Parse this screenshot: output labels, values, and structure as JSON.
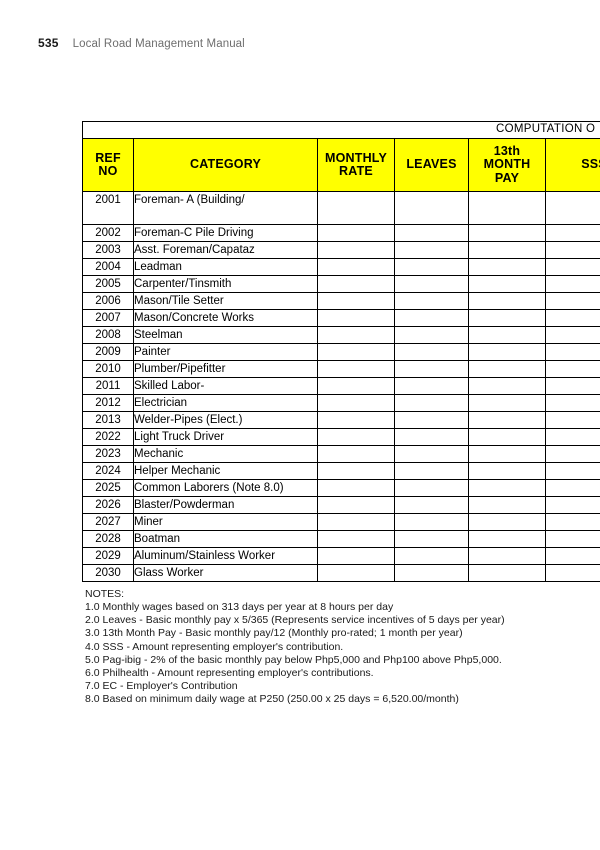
{
  "page_header": {
    "page_number": "535",
    "title": "Local Road Management Manual"
  },
  "table": {
    "banner_label": "COMPUTATION O",
    "columns": [
      {
        "key": "ref_no",
        "label": "REF\nNO"
      },
      {
        "key": "category",
        "label": "CATEGORY"
      },
      {
        "key": "monthly",
        "label": "MONTHLY\nRATE"
      },
      {
        "key": "leaves",
        "label": "LEAVES"
      },
      {
        "key": "thirteenth",
        "label": "13th\nMONTH\nPAY"
      },
      {
        "key": "sss",
        "label": "SSS"
      }
    ],
    "column_labels": {
      "ref_no_line1": "REF",
      "ref_no_line2": "NO",
      "category": "CATEGORY",
      "monthly_line1": "MONTHLY",
      "monthly_line2": "RATE",
      "leaves": "LEAVES",
      "thirteenth_line1": "13th",
      "thirteenth_line2": "MONTH",
      "thirteenth_line3": "PAY",
      "sss": "SSS"
    },
    "rows": [
      {
        "ref_no": "2001",
        "category": "Foreman- A (Building/",
        "monthly": "",
        "leaves": "",
        "thirteenth": "",
        "sss": "",
        "tall": true
      },
      {
        "ref_no": "2002",
        "category": "Foreman-C Pile Driving",
        "monthly": "",
        "leaves": "",
        "thirteenth": "",
        "sss": "",
        "tall": false
      },
      {
        "ref_no": "2003",
        "category": "Asst. Foreman/Capataz",
        "monthly": "",
        "leaves": "",
        "thirteenth": "",
        "sss": "",
        "tall": false
      },
      {
        "ref_no": "2004",
        "category": "Leadman",
        "monthly": "",
        "leaves": "",
        "thirteenth": "",
        "sss": "",
        "tall": false
      },
      {
        "ref_no": "2005",
        "category": "Carpenter/Tinsmith",
        "monthly": "",
        "leaves": "",
        "thirteenth": "",
        "sss": "",
        "tall": false
      },
      {
        "ref_no": "2006",
        "category": "Mason/Tile Setter",
        "monthly": "",
        "leaves": "",
        "thirteenth": "",
        "sss": "",
        "tall": false
      },
      {
        "ref_no": "2007",
        "category": "Mason/Concrete Works",
        "monthly": "",
        "leaves": "",
        "thirteenth": "",
        "sss": "",
        "tall": false
      },
      {
        "ref_no": "2008",
        "category": "Steelman",
        "monthly": "",
        "leaves": "",
        "thirteenth": "",
        "sss": "",
        "tall": false
      },
      {
        "ref_no": "2009",
        "category": "Painter",
        "monthly": "",
        "leaves": "",
        "thirteenth": "",
        "sss": "",
        "tall": false
      },
      {
        "ref_no": "2010",
        "category": "Plumber/Pipefitter",
        "monthly": "",
        "leaves": "",
        "thirteenth": "",
        "sss": "",
        "tall": false
      },
      {
        "ref_no": "2011",
        "category": "Skilled Labor-",
        "monthly": "",
        "leaves": "",
        "thirteenth": "",
        "sss": "",
        "tall": false
      },
      {
        "ref_no": "2012",
        "category": "Electrician",
        "monthly": "",
        "leaves": "",
        "thirteenth": "",
        "sss": "",
        "tall": false
      },
      {
        "ref_no": "2013",
        "category": "Welder-Pipes (Elect.)",
        "monthly": "",
        "leaves": "",
        "thirteenth": "",
        "sss": "",
        "tall": false
      },
      {
        "ref_no": "2022",
        "category": "Light Truck Driver",
        "monthly": "",
        "leaves": "",
        "thirteenth": "",
        "sss": "",
        "tall": false
      },
      {
        "ref_no": "2023",
        "category": "Mechanic",
        "monthly": "",
        "leaves": "",
        "thirteenth": "",
        "sss": "",
        "tall": false
      },
      {
        "ref_no": "2024",
        "category": "Helper Mechanic",
        "monthly": "",
        "leaves": "",
        "thirteenth": "",
        "sss": "",
        "tall": false
      },
      {
        "ref_no": "2025",
        "category": "Common Laborers (Note 8.0)",
        "monthly": "",
        "leaves": "",
        "thirteenth": "",
        "sss": "",
        "tall": false
      },
      {
        "ref_no": "2026",
        "category": "Blaster/Powderman",
        "monthly": "",
        "leaves": "",
        "thirteenth": "",
        "sss": "",
        "tall": false
      },
      {
        "ref_no": "2027",
        "category": "Miner",
        "monthly": "",
        "leaves": "",
        "thirteenth": "",
        "sss": "",
        "tall": false
      },
      {
        "ref_no": "2028",
        "category": "Boatman",
        "monthly": "",
        "leaves": "",
        "thirteenth": "",
        "sss": "",
        "tall": false
      },
      {
        "ref_no": "2029",
        "category": "Aluminum/Stainless Worker",
        "monthly": "",
        "leaves": "",
        "thirteenth": "",
        "sss": "",
        "tall": false
      },
      {
        "ref_no": "2030",
        "category": "Glass Worker",
        "monthly": "",
        "leaves": "",
        "thirteenth": "",
        "sss": "",
        "tall": false
      }
    ]
  },
  "notes": {
    "title": "NOTES:",
    "items": [
      "1.0 Monthly wages based on 313 days per year at 8 hours per day",
      "2.0 Leaves - Basic monthly pay x 5/365 (Represents service incentives of 5 days per year)",
      "3.0 13th Month Pay - Basic monthly pay/12 (Monthly pro-rated; 1 month per year)",
      "4.0 SSS - Amount representing employer's contribution.",
      "5.0 Pag-ibig - 2% of the basic monthly pay below Php5,000 and Php100 above Php5,000.",
      "6.0 Philhealth - Amount representing employer's contributions.",
      "7.0 EC - Employer's Contribution",
      "8.0 Based on minimum daily wage at P250 (250.00 x 25 days = 6,520.00/month)"
    ]
  },
  "colors": {
    "header_fill": "#FFFF00",
    "border": "#000000",
    "page_background": "#FFFFFF",
    "header_title_text": "#6E6E6E"
  }
}
